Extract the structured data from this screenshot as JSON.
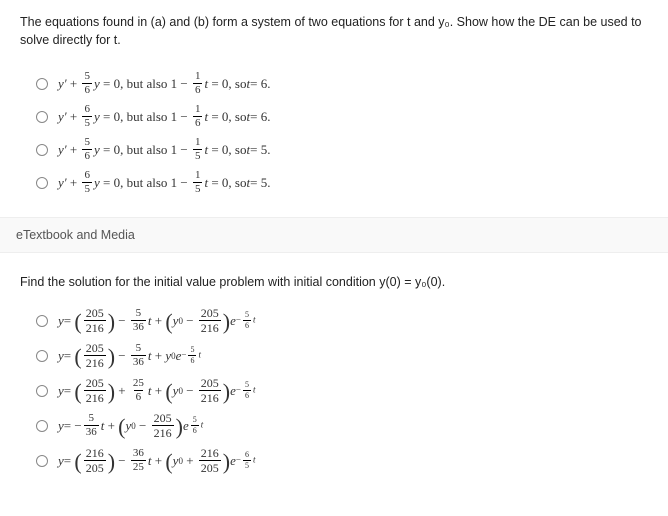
{
  "question1": {
    "prompt": "The equations found in (a) and (b) form a system of two equations for t and y₀. Show how the DE can be used to solve directly for t.",
    "options": [
      {
        "eq": "y′ + (5/6)y = 0, but also 1 − (1/6)t = 0, so t = 6."
      },
      {
        "eq": "y′ + (6/5)y = 0, but also 1 − (1/6)t = 0, so t = 6."
      },
      {
        "eq": "y′ + (5/6)y = 0, but also 1 − (1/5)t = 0, so t = 5."
      },
      {
        "eq": "y′ + (6/5)y = 0, but also 1 − (1/5)t = 0, so t = 5."
      }
    ]
  },
  "etextLabel": "eTextbook and Media",
  "question2": {
    "prompt": "Find the solution for the initial value problem with initial condition y(0) = y₀(0).",
    "options": [
      {
        "eq": "y = (205/216) − (5/36)t + (y₀ − 205/216) e^(−5t/6)"
      },
      {
        "eq": "y = (205/216) − (5/36)t + y₀ e^(−5t/6)"
      },
      {
        "eq": "y = (205/216) + (25/6)t + (y₀ − 205/216) e^(−5t/6)"
      },
      {
        "eq": "y = −(5/36)t + (y₀ − 205/216) e^(5t/6)"
      },
      {
        "eq": "y = (216/205) − (36/25)t + (y₀ + 216/205) e^(−6t/5)"
      }
    ]
  }
}
